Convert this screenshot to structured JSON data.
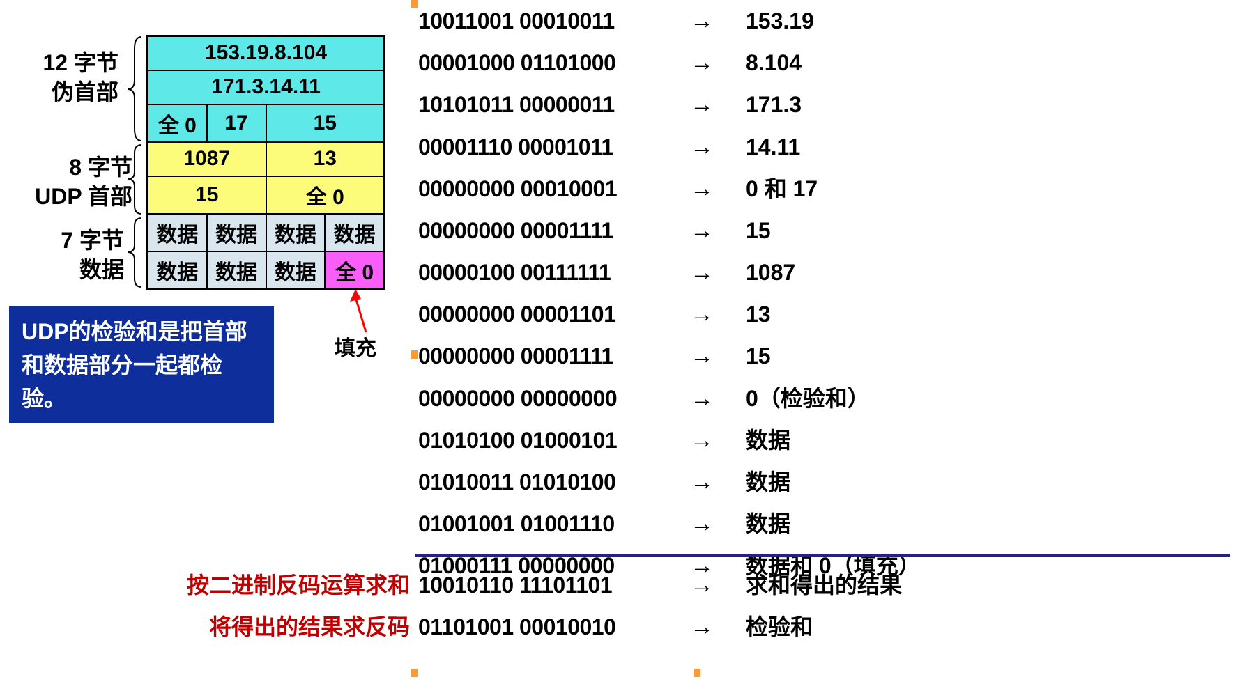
{
  "labels": {
    "pseudo_header": "12 字节\n伪首部",
    "udp_header": "8 字节\nUDP 首部",
    "data_label": "7 字节\n数据",
    "fill": "填充"
  },
  "table": {
    "src_ip": "153.19.8.104",
    "dst_ip": "171.3.14.11",
    "zero": "全 0",
    "proto": "17",
    "len": "15",
    "src_port": "1087",
    "dst_port": "13",
    "udp_len": "15",
    "checksum_zero": "全 0",
    "data": "数据",
    "pad": "全 0"
  },
  "bluebox": "UDP的检验和是把首部和数据部分一起都检验。",
  "binary": [
    {
      "bin": "10011001 00010011",
      "desc": "153.19"
    },
    {
      "bin": "00001000 01101000",
      "desc": "8.104"
    },
    {
      "bin": "10101011 00000011",
      "desc": "171.3"
    },
    {
      "bin": "00001110 00001011",
      "desc": "14.11"
    },
    {
      "bin": "00000000 00010001",
      "desc": "0 和 17"
    },
    {
      "bin": "00000000 00001111",
      "desc": "15"
    },
    {
      "bin": "00000100 00111111",
      "desc": "1087"
    },
    {
      "bin": "00000000 00001101",
      "desc": "13"
    },
    {
      "bin": "00000000 00001111",
      "desc": "15"
    },
    {
      "bin": "00000000 00000000",
      "desc": "0（检验和）"
    },
    {
      "bin": "01010100 01000101",
      "desc": "数据"
    },
    {
      "bin": "01010011 01010100",
      "desc": "数据"
    },
    {
      "bin": "01001001 01001110",
      "desc": "数据"
    },
    {
      "bin": "01000111 00000000",
      "desc": "数据和 0（填充）"
    }
  ],
  "bottom": {
    "sum_label": "按二进制反码运算求和",
    "sum_bin": "10010110 11101101",
    "sum_desc": "求和得出的结果",
    "inv_label": "将得出的结果求反码",
    "inv_bin": "01101001 00010010",
    "inv_desc": "检验和"
  }
}
